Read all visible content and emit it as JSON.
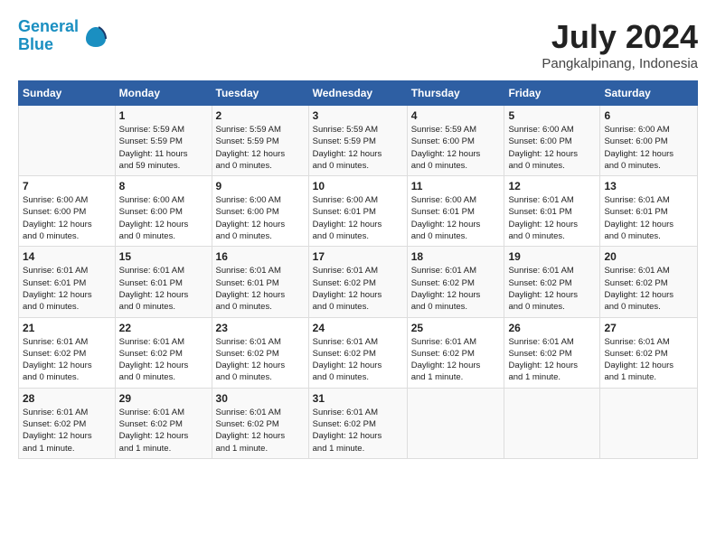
{
  "logo": {
    "line1": "General",
    "line2": "Blue"
  },
  "title": "July 2024",
  "location": "Pangkalpinang, Indonesia",
  "days_of_week": [
    "Sunday",
    "Monday",
    "Tuesday",
    "Wednesday",
    "Thursday",
    "Friday",
    "Saturday"
  ],
  "weeks": [
    [
      {
        "day": "",
        "content": ""
      },
      {
        "day": "1",
        "content": "Sunrise: 5:59 AM\nSunset: 5:59 PM\nDaylight: 11 hours\nand 59 minutes."
      },
      {
        "day": "2",
        "content": "Sunrise: 5:59 AM\nSunset: 5:59 PM\nDaylight: 12 hours\nand 0 minutes."
      },
      {
        "day": "3",
        "content": "Sunrise: 5:59 AM\nSunset: 5:59 PM\nDaylight: 12 hours\nand 0 minutes."
      },
      {
        "day": "4",
        "content": "Sunrise: 5:59 AM\nSunset: 6:00 PM\nDaylight: 12 hours\nand 0 minutes."
      },
      {
        "day": "5",
        "content": "Sunrise: 6:00 AM\nSunset: 6:00 PM\nDaylight: 12 hours\nand 0 minutes."
      },
      {
        "day": "6",
        "content": "Sunrise: 6:00 AM\nSunset: 6:00 PM\nDaylight: 12 hours\nand 0 minutes."
      }
    ],
    [
      {
        "day": "7",
        "content": "Sunrise: 6:00 AM\nSunset: 6:00 PM\nDaylight: 12 hours\nand 0 minutes."
      },
      {
        "day": "8",
        "content": "Sunrise: 6:00 AM\nSunset: 6:00 PM\nDaylight: 12 hours\nand 0 minutes."
      },
      {
        "day": "9",
        "content": "Sunrise: 6:00 AM\nSunset: 6:00 PM\nDaylight: 12 hours\nand 0 minutes."
      },
      {
        "day": "10",
        "content": "Sunrise: 6:00 AM\nSunset: 6:01 PM\nDaylight: 12 hours\nand 0 minutes."
      },
      {
        "day": "11",
        "content": "Sunrise: 6:00 AM\nSunset: 6:01 PM\nDaylight: 12 hours\nand 0 minutes."
      },
      {
        "day": "12",
        "content": "Sunrise: 6:01 AM\nSunset: 6:01 PM\nDaylight: 12 hours\nand 0 minutes."
      },
      {
        "day": "13",
        "content": "Sunrise: 6:01 AM\nSunset: 6:01 PM\nDaylight: 12 hours\nand 0 minutes."
      }
    ],
    [
      {
        "day": "14",
        "content": "Sunrise: 6:01 AM\nSunset: 6:01 PM\nDaylight: 12 hours\nand 0 minutes."
      },
      {
        "day": "15",
        "content": "Sunrise: 6:01 AM\nSunset: 6:01 PM\nDaylight: 12 hours\nand 0 minutes."
      },
      {
        "day": "16",
        "content": "Sunrise: 6:01 AM\nSunset: 6:01 PM\nDaylight: 12 hours\nand 0 minutes."
      },
      {
        "day": "17",
        "content": "Sunrise: 6:01 AM\nSunset: 6:02 PM\nDaylight: 12 hours\nand 0 minutes."
      },
      {
        "day": "18",
        "content": "Sunrise: 6:01 AM\nSunset: 6:02 PM\nDaylight: 12 hours\nand 0 minutes."
      },
      {
        "day": "19",
        "content": "Sunrise: 6:01 AM\nSunset: 6:02 PM\nDaylight: 12 hours\nand 0 minutes."
      },
      {
        "day": "20",
        "content": "Sunrise: 6:01 AM\nSunset: 6:02 PM\nDaylight: 12 hours\nand 0 minutes."
      }
    ],
    [
      {
        "day": "21",
        "content": "Sunrise: 6:01 AM\nSunset: 6:02 PM\nDaylight: 12 hours\nand 0 minutes."
      },
      {
        "day": "22",
        "content": "Sunrise: 6:01 AM\nSunset: 6:02 PM\nDaylight: 12 hours\nand 0 minutes."
      },
      {
        "day": "23",
        "content": "Sunrise: 6:01 AM\nSunset: 6:02 PM\nDaylight: 12 hours\nand 0 minutes."
      },
      {
        "day": "24",
        "content": "Sunrise: 6:01 AM\nSunset: 6:02 PM\nDaylight: 12 hours\nand 0 minutes."
      },
      {
        "day": "25",
        "content": "Sunrise: 6:01 AM\nSunset: 6:02 PM\nDaylight: 12 hours\nand 1 minute."
      },
      {
        "day": "26",
        "content": "Sunrise: 6:01 AM\nSunset: 6:02 PM\nDaylight: 12 hours\nand 1 minute."
      },
      {
        "day": "27",
        "content": "Sunrise: 6:01 AM\nSunset: 6:02 PM\nDaylight: 12 hours\nand 1 minute."
      }
    ],
    [
      {
        "day": "28",
        "content": "Sunrise: 6:01 AM\nSunset: 6:02 PM\nDaylight: 12 hours\nand 1 minute."
      },
      {
        "day": "29",
        "content": "Sunrise: 6:01 AM\nSunset: 6:02 PM\nDaylight: 12 hours\nand 1 minute."
      },
      {
        "day": "30",
        "content": "Sunrise: 6:01 AM\nSunset: 6:02 PM\nDaylight: 12 hours\nand 1 minute."
      },
      {
        "day": "31",
        "content": "Sunrise: 6:01 AM\nSunset: 6:02 PM\nDaylight: 12 hours\nand 1 minute."
      },
      {
        "day": "",
        "content": ""
      },
      {
        "day": "",
        "content": ""
      },
      {
        "day": "",
        "content": ""
      }
    ]
  ]
}
